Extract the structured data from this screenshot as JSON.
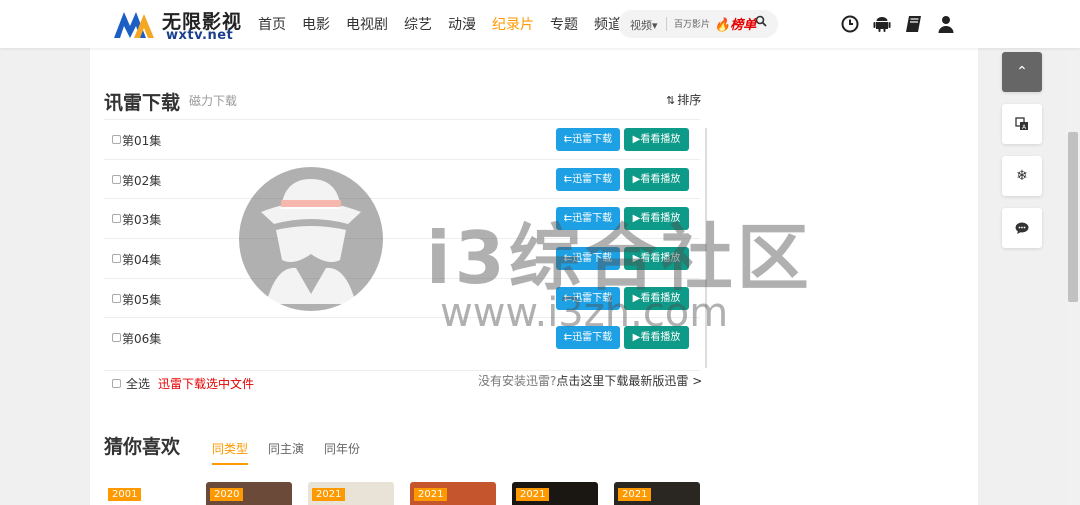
{
  "header": {
    "logo_cn": "无限影视",
    "logo_en": "wxtv.net",
    "nav": [
      {
        "label": "首页",
        "active": false
      },
      {
        "label": "电影",
        "active": false
      },
      {
        "label": "电视剧",
        "active": false
      },
      {
        "label": "综艺",
        "active": false
      },
      {
        "label": "动漫",
        "active": false
      },
      {
        "label": "纪录片",
        "active": true
      },
      {
        "label": "专题",
        "active": false
      },
      {
        "label": "频道",
        "active": false
      }
    ],
    "search": {
      "type_label": "视频",
      "placeholder": "百万影片",
      "hot_label": "榜单"
    },
    "icons": [
      "history-icon",
      "android-icon",
      "book-icon",
      "user-icon"
    ]
  },
  "download": {
    "title": "讯雷下载",
    "subtitle": "磁力下载",
    "sort_label": "排序",
    "episodes": [
      "第01集",
      "第02集",
      "第03集",
      "第04集",
      "第05集",
      "第06集"
    ],
    "download_btn": "迅雷下载",
    "play_btn": "看看播放",
    "select_all": "全选",
    "download_selected": "迅雷下载选中文件",
    "hint": "没有安装迅雷?",
    "hint_link": "点击这里下载最新版迅雷 >"
  },
  "guess": {
    "title": "猜你喜欢",
    "tabs": [
      {
        "label": "同类型",
        "active": true
      },
      {
        "label": "同主演",
        "active": false
      },
      {
        "label": "同年份",
        "active": false
      }
    ],
    "thumbs": [
      {
        "year": "2001",
        "color": "#ffffff"
      },
      {
        "year": "2020",
        "color": "#6b4a3a"
      },
      {
        "year": "2021",
        "color": "#e8e3d6"
      },
      {
        "year": "2021",
        "color": "#c4552c"
      },
      {
        "year": "2021",
        "color": "#1a1712"
      },
      {
        "year": "2021",
        "color": "#2a2622"
      }
    ]
  },
  "side": {
    "top_icon": "chevron-up-icon",
    "items": [
      "translate-icon",
      "snowflake-icon",
      "chat-icon"
    ]
  },
  "watermark": {
    "text": "i3综合社区",
    "url": "www.i3zh.com"
  },
  "colors": {
    "accent": "#ff9900",
    "download_blue": "#1ea0e4",
    "play_green": "#0d9a88",
    "link_red": "#e60000"
  }
}
